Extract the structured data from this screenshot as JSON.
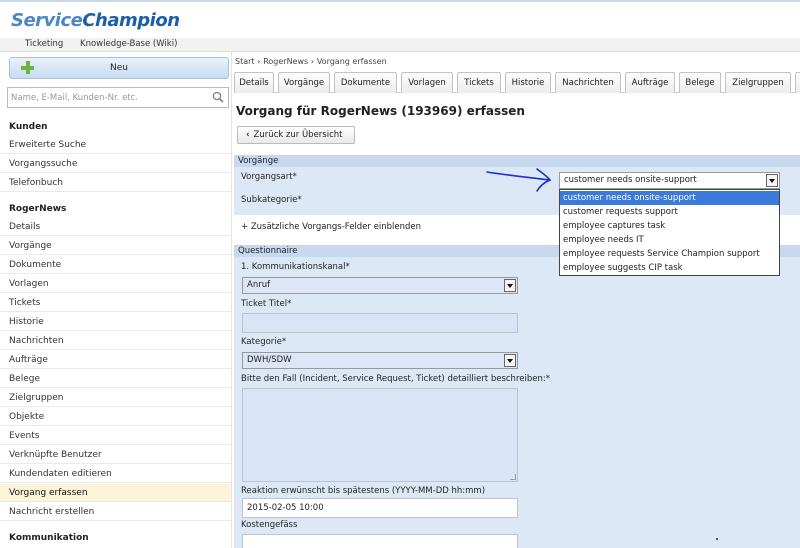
{
  "app": {
    "logo_part1": "Service",
    "logo_part2": "Champion",
    "menu": [
      "Ticketing",
      "Knowledge-Base (Wiki)"
    ]
  },
  "sidebar": {
    "new_button": "Neu",
    "search_placeholder": "Name, E-Mail, Kunden-Nr. etc.",
    "section_kunden": "Kunden",
    "kunden_items": [
      "Erweiterte Suche",
      "Vorgangssuche",
      "Telefonbuch"
    ],
    "section_customer": "RogerNews",
    "customer_items": [
      "Details",
      "Vorgänge",
      "Dokumente",
      "Vorlagen",
      "Tickets",
      "Historie",
      "Nachrichten",
      "Aufträge",
      "Belege",
      "Zielgruppen",
      "Objekte",
      "Events",
      "Verknüpfte Benutzer",
      "Kundendaten editieren",
      "Vorgang erfassen",
      "Nachricht erstellen"
    ],
    "active_item": "Vorgang erfassen",
    "section_kommunikation": "Kommunikation"
  },
  "breadcrumb": [
    "Start",
    "RogerNews",
    "Vorgang erfassen"
  ],
  "tabs": [
    "Details",
    "Vorgänge",
    "Dokumente",
    "Vorlagen",
    "Tickets",
    "Historie",
    "Nachrichten",
    "Aufträge",
    "Belege",
    "Zielgruppen"
  ],
  "page_title": "Vorgang für RogerNews (193969) erfassen",
  "back_button": "Zurück zur Übersicht",
  "vorgaenge": {
    "heading": "Vorgänge",
    "vorgangsart_label": "Vorgangsart*",
    "vorgangsart_value": "customer needs onsite-support",
    "subkategorie_label": "Subkategorie*",
    "extra_fields_link": "+ Zusätzliche Vorgangs-Felder einblenden",
    "dropdown_options": [
      "customer needs onsite-support",
      "customer requests support",
      "employee captures task",
      "employee needs IT",
      "employee requests Service Champion support",
      "employee suggests CIP task"
    ],
    "dropdown_selected_index": 0
  },
  "questionnaire": {
    "heading": "Questionnaire",
    "kanal_label": "1. Kommunikationskanal*",
    "kanal_value": "Anruf",
    "titel_label": "Ticket Titel*",
    "titel_value": "",
    "kategorie_label": "Kategorie*",
    "kategorie_value": "DWH/SDW",
    "beschreibung_label": "Bitte den Fall (Incident, Service Request, Ticket) detailliert beschreiben:*",
    "reaktion_label": "Reaktion erwünscht bis spätestens (YYYY-MM-DD hh:mm)",
    "reaktion_value": "2015-02-05 10:00",
    "kostengefaess_label": "Kostengefäss"
  },
  "colors": {
    "logo_light": "#4a86c8",
    "logo_dark": "#1c5fa8",
    "section_header": "#c8d9ef",
    "field_bg": "#d9e4f6",
    "dropdown_highlight": "#3a7ad9",
    "annotation_arrow": "#1a2fd0",
    "active_nav": "#fdf3d9"
  }
}
